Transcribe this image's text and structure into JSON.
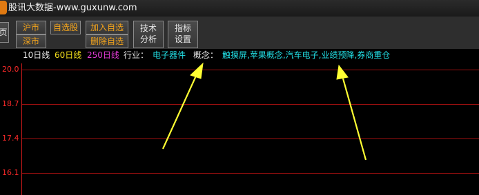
{
  "window": {
    "title": "股讯大数据-www.guxunw.com"
  },
  "toolbar": {
    "page_btn": "页",
    "sh_market": "沪市",
    "sz_market": "深市",
    "self_select": "自选股",
    "add_self": "加入自选",
    "del_self": "删除自选",
    "tech_line1": "技术",
    "tech_line2": "分析",
    "index_line1": "指标",
    "index_line2": "设置"
  },
  "info": {
    "ma10": "10日线",
    "ma60": "60日线",
    "ma250": "250日线",
    "industry_label": "行业：",
    "industry_value": "电子器件",
    "concept_label": "概念：",
    "concept_value": "触摸屏,苹果概念,汽车电子,业绩预降,券商重仓"
  },
  "chart_data": {
    "type": "line",
    "yticks": [
      "20.0",
      "18.7",
      "17.4",
      "16.1"
    ],
    "series": [],
    "grid": true
  },
  "colors": {
    "ma10": "#e8e8e8",
    "ma60": "#f5e11c",
    "ma250": "#e23bd6",
    "cyan": "#22e0e6",
    "axis_red": "#ff2a2a",
    "arrow": "#ffff33"
  }
}
